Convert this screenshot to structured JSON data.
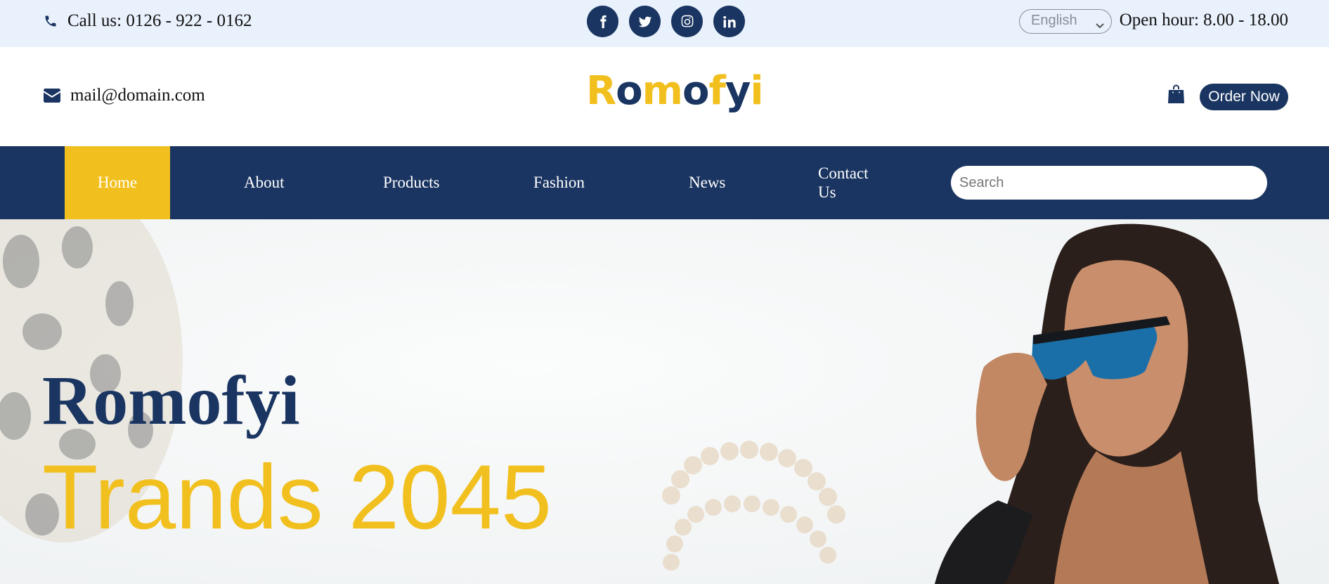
{
  "topbar": {
    "phone_text": "Call us: 0126 - 922 - 0162",
    "socials": [
      "facebook",
      "twitter",
      "instagram",
      "linkedin"
    ],
    "language": "English",
    "hours": "Open hour: 8.00 - 18.00"
  },
  "header": {
    "email": "mail@domain.com",
    "logo_parts": [
      "R",
      "o",
      "m",
      "o",
      "f",
      "y",
      "i"
    ],
    "order_button": "Order Now"
  },
  "nav": {
    "items": [
      "Home",
      "About",
      "Products",
      "Fashion",
      "News",
      "Contact Us"
    ],
    "active": "Home",
    "search_placeholder": "Search"
  },
  "hero": {
    "title": "Romofyi",
    "subtitle": "Trands 2045"
  },
  "colors": {
    "navy": "#1a3561",
    "yellow": "#f2c01e",
    "topbar_bg": "#e9f1fc"
  }
}
